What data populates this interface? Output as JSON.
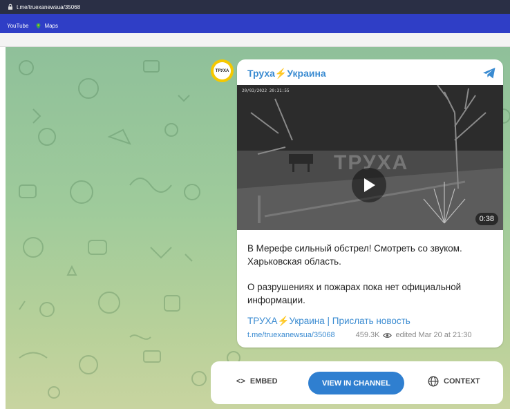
{
  "browser": {
    "url": "t.me/truexanewsua/35068",
    "bookmarks": [
      {
        "label": "YouTube"
      },
      {
        "label": "Maps"
      }
    ]
  },
  "channel": {
    "name": "Труха⚡Украина",
    "avatar_text": "ТРУХА"
  },
  "video": {
    "timestamp": "20/03/2022 20:31:55",
    "watermark": "ТРУХА",
    "duration": "0:38"
  },
  "post": {
    "paragraphs": [
      "В Мерефе сильный обстрел! Смотреть со звуком. Харьковская область.",
      "О разрушениях и пожарах пока нет официальной информации."
    ],
    "link_channel": "ТРУХА⚡Украина",
    "link_separator": "|",
    "link_send": "Прислать новость",
    "post_url": "t.me/truexanewsua/35068",
    "views": "459.3K",
    "edited": "edited  Mar 20 at 21:30"
  },
  "actions": {
    "embed": "EMBED",
    "view_in_channel": "VIEW IN CHANNEL",
    "context": "CONTEXT"
  },
  "colors": {
    "accent": "#3a8bd1",
    "button": "#2f7fd0",
    "bookmarks_bar": "#2f3ec6"
  }
}
